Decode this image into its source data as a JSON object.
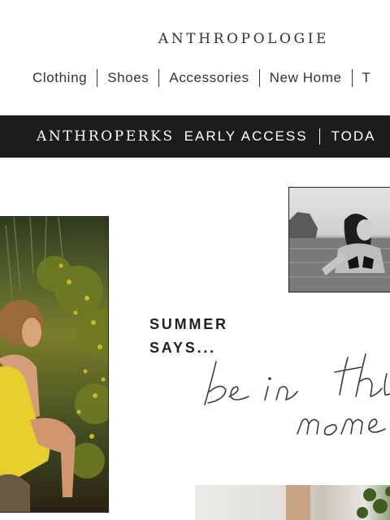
{
  "header": {
    "logo": "ANTHROPOLOGIE",
    "nav": [
      {
        "label": "Clothing"
      },
      {
        "label": "Shoes"
      },
      {
        "label": "Accessories"
      },
      {
        "label": "New Home"
      },
      {
        "label": "T"
      }
    ]
  },
  "promo": {
    "brand": "ANTHROPERKS",
    "label": "EARLY ACCESS",
    "today": "TODA"
  },
  "hero": {
    "headline_line1": "SUMMER",
    "headline_line2": "SAYS..."
  },
  "colors": {
    "promo_bg": "#1c1c1c",
    "text": "#222222"
  }
}
